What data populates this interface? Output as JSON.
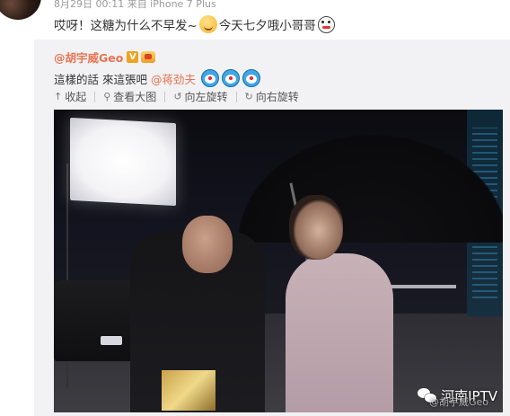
{
  "post": {
    "meta": "8月29日 00:11 来自 iPhone 7 Plus",
    "text_part1": "哎呀！这糖为什么不早发~",
    "text_part2": "今天七夕哦小哥哥"
  },
  "repost": {
    "author": "@胡宇威Geo",
    "verified_badge": "V",
    "text": "這樣的話 來這張吧",
    "mention": "@蒋劲夫"
  },
  "actions": {
    "collapse": "收起",
    "view_large": "查看大图",
    "rotate_left": "向左旋转",
    "rotate_right": "向右旋转"
  },
  "watermark": {
    "brand": "河南IPTV",
    "sub": "@胡宇威Geo"
  },
  "colors": {
    "accent": "#eb7350",
    "repost_bg": "#f2f2f5"
  }
}
